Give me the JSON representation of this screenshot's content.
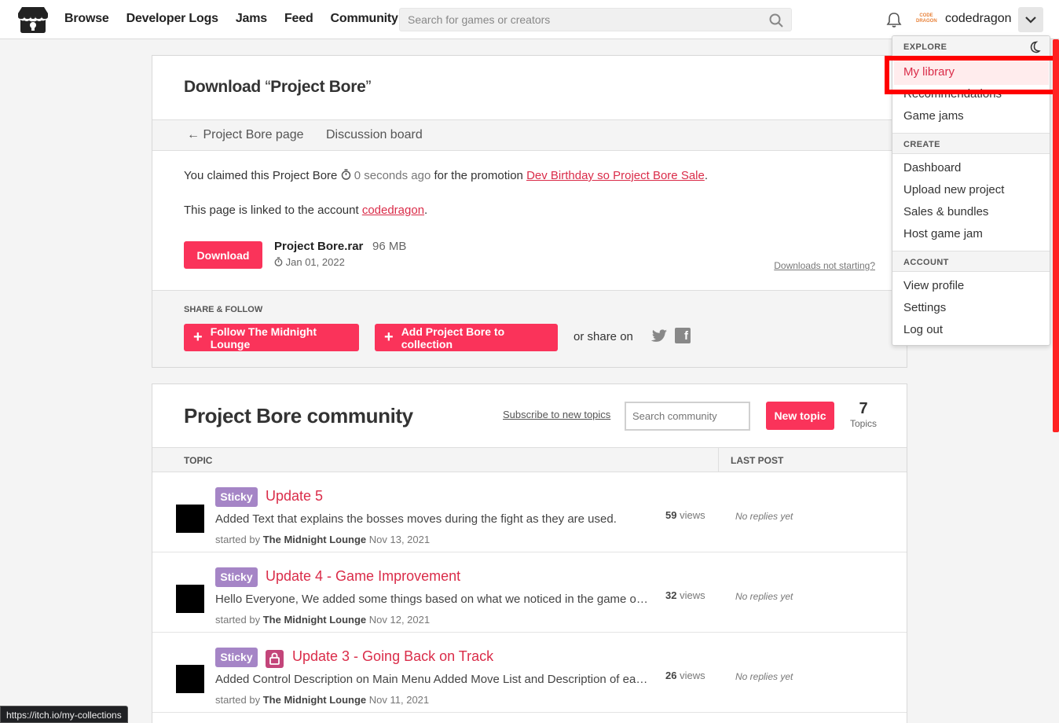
{
  "header": {
    "nav": [
      "Browse",
      "Developer Logs",
      "Jams",
      "Feed",
      "Community"
    ],
    "search_placeholder": "Search for games or creators",
    "username": "codedragon",
    "avatar_text": "CODE DRAGON"
  },
  "download": {
    "title_prefix": "Download ",
    "title_open": "“",
    "title_name": "Project Bore",
    "title_close": "”",
    "tab_back": "← Project Bore page",
    "tab_discussion": "Discussion board",
    "claim_text": "You claimed this Project Bore",
    "claim_time": "0 seconds ago",
    "claim_mid": "for the promotion",
    "claim_link": "Dev Birthday so Project Bore Sale",
    "linked_text": "This page is linked to the account",
    "linked_account": "codedragon",
    "download_button": "Download",
    "file_name": "Project Bore.rar",
    "file_size": "96 MB",
    "file_date": "Jan 01, 2022",
    "help_link": "Downloads not starting?",
    "share_heading": "SHARE & FOLLOW",
    "follow_button": "Follow The Midnight Lounge",
    "collection_button": "Add Project Bore to collection",
    "share_on": "or share on"
  },
  "community": {
    "title": "Project Bore community",
    "subscribe": "Subscribe to new topics",
    "search_placeholder": "Search community",
    "new_topic": "New topic",
    "topics_count": "7",
    "topics_label": "Topics",
    "col_topic": "TOPIC",
    "col_last_post": "LAST POST",
    "rows": [
      {
        "badge": "Sticky",
        "title": "Update 5",
        "desc": "Added Text that explains the bosses moves during the fight as they are used.",
        "started_by": "started by",
        "author": "The Midnight Lounge",
        "date": "Nov 13, 2021",
        "views_n": "59",
        "views_label": "views",
        "last_post": "No replies yet"
      },
      {
        "badge": "Sticky",
        "title": "Update 4 - Game Improvement",
        "desc": "Hello Everyone, We added some things based on what we noticed in the game over the past few days",
        "started_by": "started by",
        "author": "The Midnight Lounge",
        "date": "Nov 12, 2021",
        "views_n": "32",
        "views_label": "views",
        "last_post": "No replies yet"
      },
      {
        "badge": "Sticky",
        "title": "Update 3 - Going Back on Track",
        "desc": "Added Control Description on Main Menu Added Move List and Description of each move",
        "started_by": "started by",
        "author": "The Midnight Lounge",
        "date": "Nov 11, 2021",
        "views_n": "26",
        "views_label": "views",
        "last_post": "No replies yet"
      }
    ]
  },
  "menu": {
    "explore": "EXPLORE",
    "my_library": "My library",
    "recommendations": "Recommendations",
    "game_jams": "Game jams",
    "create": "CREATE",
    "dashboard": "Dashboard",
    "upload": "Upload new project",
    "sales": "Sales & bundles",
    "host_jam": "Host game jam",
    "account": "ACCOUNT",
    "view_profile": "View profile",
    "settings": "Settings",
    "log_out": "Log out"
  },
  "status_url": "https://itch.io/my-collections",
  "colors": {
    "accent": "#fa335a",
    "link": "#da2c49",
    "sticky": "#a585c6",
    "highlight": "#ff0000"
  }
}
